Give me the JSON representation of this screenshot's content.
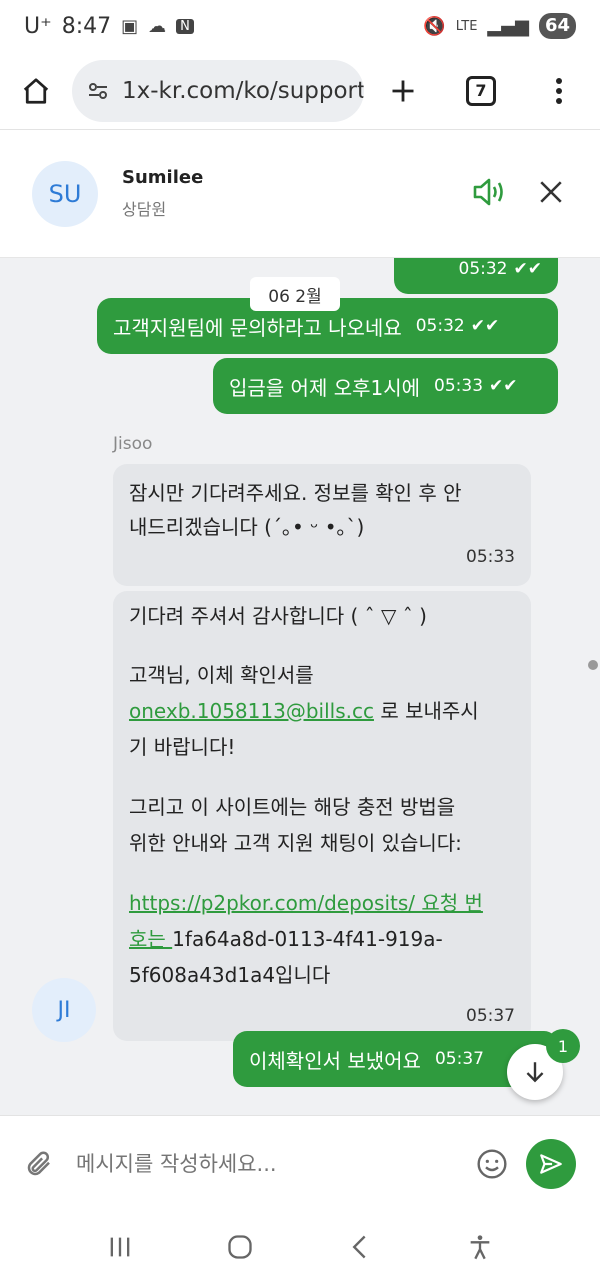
{
  "status": {
    "carrier": "U⁺",
    "time": "8:47",
    "network": "LTE",
    "battery": "64"
  },
  "browser": {
    "url": "1x-kr.com/ko/support",
    "tab_count": "7"
  },
  "chat_header": {
    "avatar_initials": "SU",
    "name": "Sumilee",
    "role": "상담원"
  },
  "date_chip": "06 2월",
  "outgoing": [
    {
      "text": "",
      "time": "05:32"
    },
    {
      "text": "고객지원팀에 문의하라고 나오네요",
      "time": "05:32"
    },
    {
      "text": "입금을 어제 오후1시에",
      "time": "05:33"
    },
    {
      "text": "이체확인서 보냈어요",
      "time": "05:37"
    }
  ],
  "sender_name": "Jisoo",
  "incoming": [
    {
      "line1": "잠시만 기다려주세요. 정보를 확인 후 안",
      "line2": "내드리겠습니다 (´｡• ᵕ •｡`)",
      "time": "05:33"
    }
  ],
  "incoming2": {
    "p1": "기다려 주셔서 감사합니다 ( ˆ ▽ ˆ )",
    "p2_a": "고객님, 이체 확인서를",
    "p2_email": "onexb.1058113@bills.cc",
    "p2_b": " 로 보내주시",
    "p2_c": "기 바랍니다!",
    "p3_a": "그리고 이 사이트에는 해당 충전 방법을",
    "p3_b": "위한 안내와 고객 지원 채팅이 있습니다:",
    "p4_link_a": "https://p2pkor.com/deposits/ 요청 번",
    "p4_link_b": "호는 ",
    "p4_text_a": "1fa64a8d-0113-4f41-919a-",
    "p4_text_b": "5f608a43d1a4입니다",
    "time": "05:37"
  },
  "agent_avatar_initials": "JI",
  "unread_badge": "1",
  "composer": {
    "placeholder": "메시지를 작성하세요..."
  },
  "colors": {
    "accent": "#2f9b3e",
    "avatar_bg": "#e3eefb",
    "avatar_text": "#2e7bd6"
  }
}
